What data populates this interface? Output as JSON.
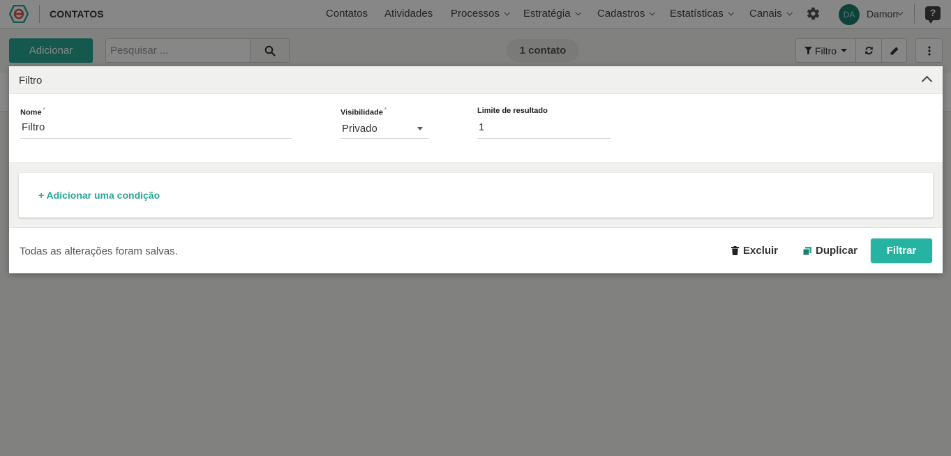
{
  "header": {
    "app_title": "CONTATOS",
    "nav": [
      {
        "label": "Contatos",
        "dropdown": false
      },
      {
        "label": "Atividades",
        "dropdown": false
      },
      {
        "label": "Processos",
        "dropdown": true
      },
      {
        "label": "Estratégia",
        "dropdown": true
      },
      {
        "label": "Cadastros",
        "dropdown": true
      },
      {
        "label": "Estatísticas",
        "dropdown": true
      },
      {
        "label": "Canais",
        "dropdown": true
      }
    ],
    "user": {
      "initials": "DA",
      "name": "Damon"
    },
    "help_label": "?"
  },
  "toolbar": {
    "add_label": "Adicionar",
    "search_placeholder": "Pesquisar ...",
    "count_label": "1 contato",
    "filter_label": "Filtro"
  },
  "filter_modal": {
    "title": "Filtro",
    "fields": {
      "name": {
        "label": "Nome",
        "required_mark": "*",
        "value": "Filtro"
      },
      "visibility": {
        "label": "Visibilidade",
        "required_mark": "*",
        "value": "Privado"
      },
      "limit": {
        "label": "Limite de resultado",
        "value": "1"
      }
    },
    "add_condition_label": "+ Adicionar uma condição",
    "saved_status": "Todas as alterações foram salvas.",
    "delete_label": "Excluir",
    "duplicate_label": "Duplicar",
    "apply_label": "Filtrar"
  },
  "colors": {
    "accent": "#26a694",
    "avatar": "#1e7d6e"
  }
}
